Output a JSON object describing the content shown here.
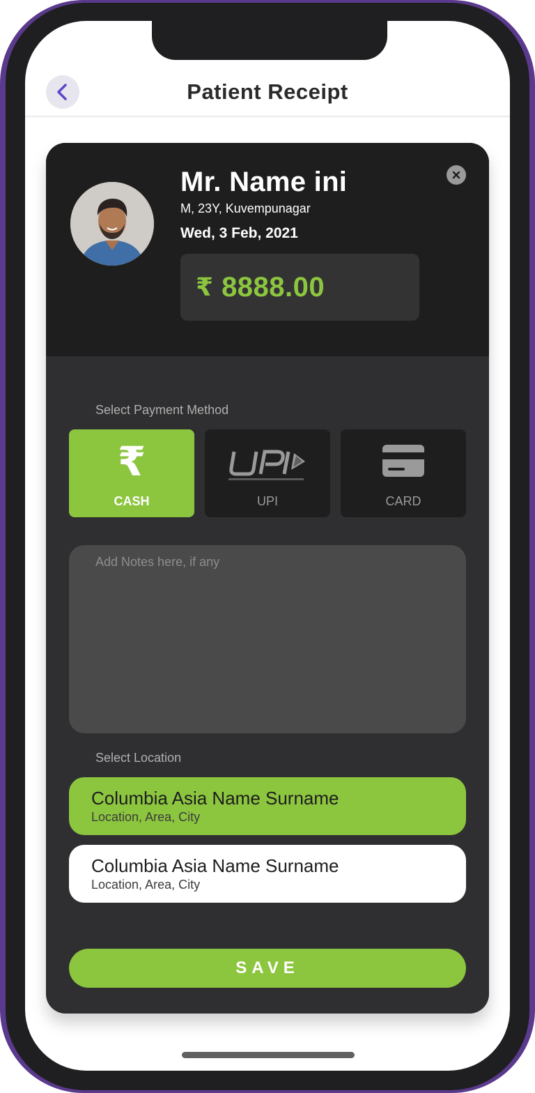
{
  "header": {
    "title": "Patient Receipt",
    "back_icon": "chevron-left-icon"
  },
  "patient": {
    "name": "Mr. Name ini",
    "info": "M, 23Y, Kuvempunagar",
    "date": "Wed, 3 Feb, 2021",
    "avatar_icon": "patient-avatar"
  },
  "amount": {
    "symbol": "₹",
    "value": "8888.00"
  },
  "payment": {
    "section_label": "Select Payment Method",
    "methods": [
      {
        "label": "CASH",
        "icon": "rupee-icon",
        "selected": true
      },
      {
        "label": "UPI",
        "icon": "upi-logo-icon",
        "selected": false
      },
      {
        "label": "CARD",
        "icon": "credit-card-icon",
        "selected": false
      }
    ]
  },
  "notes": {
    "placeholder": "Add Notes here, if any"
  },
  "location": {
    "section_label": "Select Location",
    "items": [
      {
        "name": "Columbia Asia Name Surname",
        "sub": "Location, Area, City",
        "selected": true
      },
      {
        "name": "Columbia Asia Name Surname",
        "sub": "Location, Area, City",
        "selected": false
      }
    ]
  },
  "actions": {
    "save_label": "SAVE"
  },
  "colors": {
    "accent": "#8cc63f",
    "card_bg": "#2f2f31",
    "card_top_bg": "#1e1e1e",
    "frame": "#5b3a8e"
  }
}
